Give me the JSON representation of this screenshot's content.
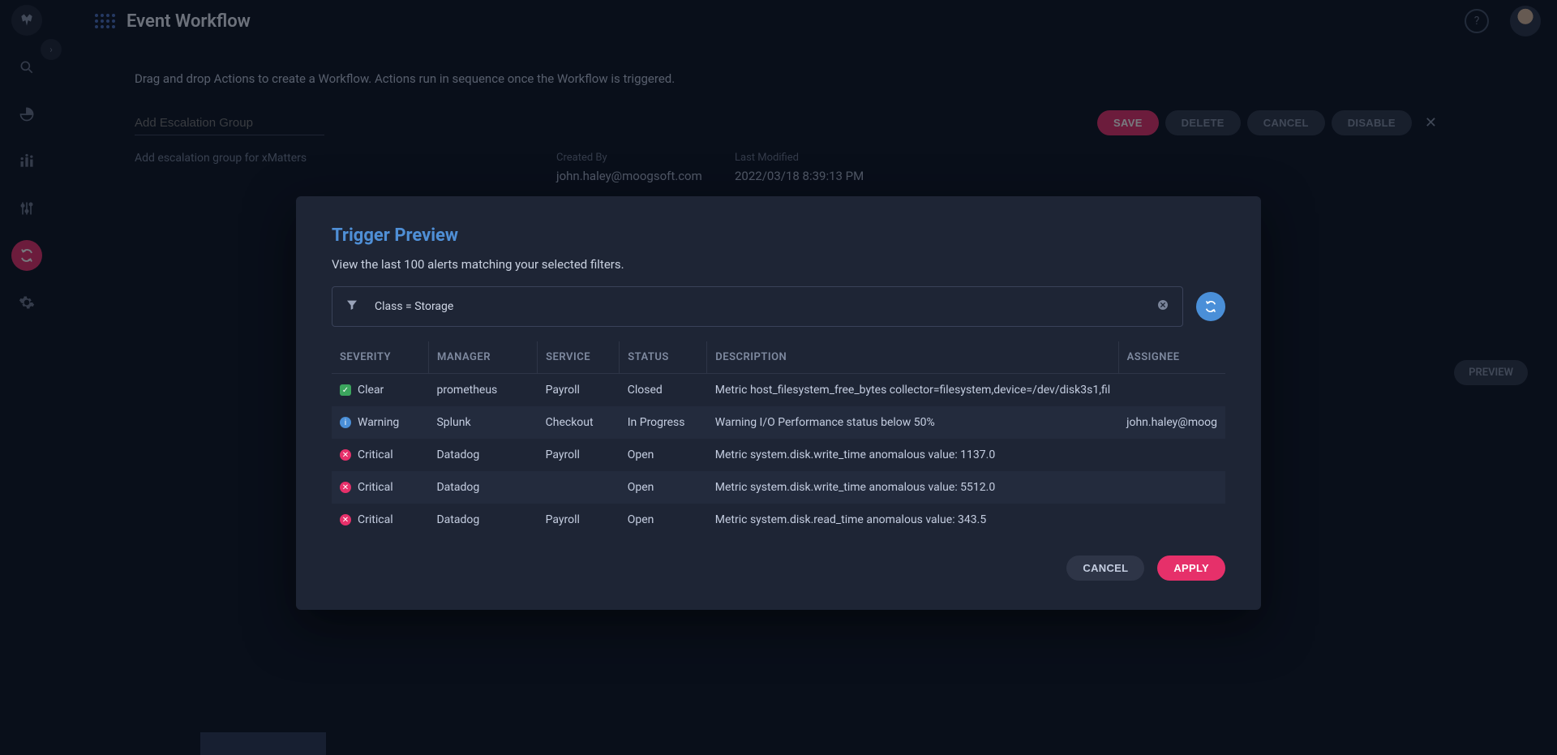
{
  "page": {
    "title": "Event Workflow"
  },
  "intro": "Drag and drop Actions to create a Workflow. Actions run in sequence once the Workflow is triggered.",
  "input": {
    "placeholder": "Add Escalation Group"
  },
  "buttons": {
    "save": "SAVE",
    "delete": "DELETE",
    "cancel": "CANCEL",
    "disable": "DISABLE"
  },
  "desc": "Add escalation group for xMatters",
  "meta": {
    "createdByLabel": "Created By",
    "createdBy": "john.haley@moogsoft.com",
    "lastModifiedLabel": "Last Modified",
    "lastModified": "2022/03/18 8:39:13 PM"
  },
  "preview": "PREVIEW",
  "modal": {
    "title": "Trigger Preview",
    "subtitle": "View the last 100 alerts matching your selected filters.",
    "filter": "Class = Storage",
    "columns": {
      "severity": "SEVERITY",
      "manager": "MANAGER",
      "service": "SERVICE",
      "status": "STATUS",
      "description": "DESCRIPTION",
      "assignee": "ASSIGNEE"
    },
    "rows": [
      {
        "severity": "Clear",
        "sevClass": "sev-clear",
        "manager": "prometheus",
        "service": "Payroll",
        "status": "Closed",
        "description": "Metric host_filesystem_free_bytes collector=filesystem,device=/dev/disk3s1,fil",
        "assignee": ""
      },
      {
        "severity": "Warning",
        "sevClass": "sev-warn",
        "manager": "Splunk",
        "service": "Checkout",
        "status": "In Progress",
        "description": "Warning I/O Performance status below 50%",
        "assignee": "john.haley@moog"
      },
      {
        "severity": "Critical",
        "sevClass": "sev-crit",
        "manager": "Datadog",
        "service": "Payroll",
        "status": "Open",
        "description": "Metric system.disk.write_time anomalous value: 1137.0",
        "assignee": ""
      },
      {
        "severity": "Critical",
        "sevClass": "sev-crit",
        "manager": "Datadog",
        "service": "",
        "status": "Open",
        "description": "Metric system.disk.write_time anomalous value: 5512.0",
        "assignee": ""
      },
      {
        "severity": "Critical",
        "sevClass": "sev-crit",
        "manager": "Datadog",
        "service": "Payroll",
        "status": "Open",
        "description": "Metric system.disk.read_time anomalous value: 343.5",
        "assignee": ""
      }
    ],
    "cancel": "CANCEL",
    "apply": "APPLY"
  }
}
